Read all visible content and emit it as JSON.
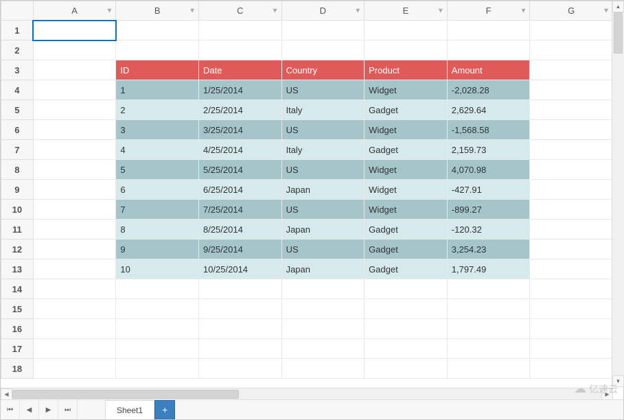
{
  "columns": [
    "A",
    "B",
    "C",
    "D",
    "E",
    "F",
    "G"
  ],
  "row_numbers": [
    1,
    2,
    3,
    4,
    5,
    6,
    7,
    8,
    9,
    10,
    11,
    12,
    13,
    14,
    15,
    16,
    17,
    18
  ],
  "table_headers": [
    "ID",
    "Date",
    "Country",
    "Product",
    "Amount"
  ],
  "table_rows": [
    {
      "id": "1",
      "date": "1/25/2014",
      "country": "US",
      "product": "Widget",
      "amount": "-2,028.28"
    },
    {
      "id": "2",
      "date": "2/25/2014",
      "country": "Italy",
      "product": "Gadget",
      "amount": "2,629.64"
    },
    {
      "id": "3",
      "date": "3/25/2014",
      "country": "US",
      "product": "Widget",
      "amount": "-1,568.58"
    },
    {
      "id": "4",
      "date": "4/25/2014",
      "country": "Italy",
      "product": "Gadget",
      "amount": "2,159.73"
    },
    {
      "id": "5",
      "date": "5/25/2014",
      "country": "US",
      "product": "Widget",
      "amount": "4,070.98"
    },
    {
      "id": "6",
      "date": "6/25/2014",
      "country": "Japan",
      "product": "Widget",
      "amount": "-427.91"
    },
    {
      "id": "7",
      "date": "7/25/2014",
      "country": "US",
      "product": "Widget",
      "amount": "-899.27"
    },
    {
      "id": "8",
      "date": "8/25/2014",
      "country": "Japan",
      "product": "Gadget",
      "amount": "-120.32"
    },
    {
      "id": "9",
      "date": "9/25/2014",
      "country": "US",
      "product": "Gadget",
      "amount": "3,254.23"
    },
    {
      "id": "10",
      "date": "10/25/2014",
      "country": "Japan",
      "product": "Gadget",
      "amount": "1,797.49"
    }
  ],
  "sheet_tab": "Sheet1",
  "watermark": "亿速云",
  "colors": {
    "header_bg": "#e05a5a",
    "stripe_odd": "#a4c6cb",
    "stripe_even": "#d6e9ec",
    "selection": "#0073c6"
  }
}
